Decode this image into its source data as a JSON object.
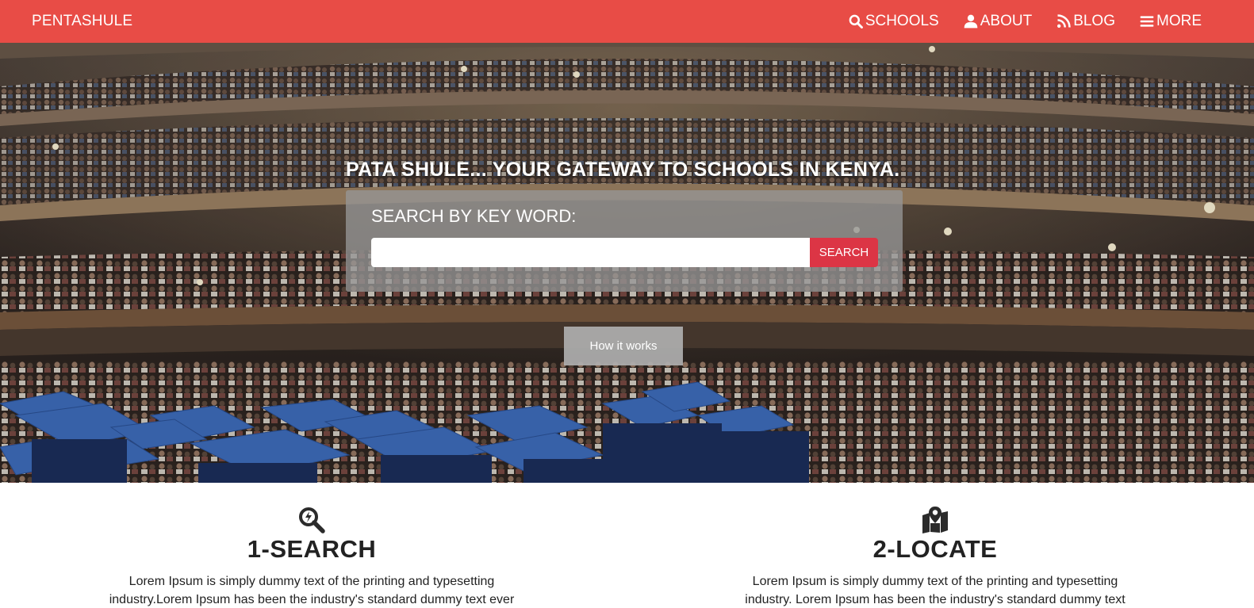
{
  "navbar": {
    "brand": "PENTASHULE",
    "links": [
      {
        "label": "SCHOOLS",
        "icon": "search-icon"
      },
      {
        "label": "ABOUT",
        "icon": "user-icon"
      },
      {
        "label": "BLOG",
        "icon": "rss-icon"
      },
      {
        "label": "MORE",
        "icon": "menu-icon"
      }
    ]
  },
  "hero": {
    "title": "PATA SHULE... YOUR GATEWAY TO SCHOOLS IN KENYA.",
    "search_label": "SEARCH BY KEY WORD:",
    "search_value": "",
    "search_button": "SEARCH",
    "how_button": "How it works"
  },
  "features": [
    {
      "title": "1-SEARCH",
      "icon": "search-bolt-icon",
      "text": "Lorem Ipsum is simply dummy text of the printing and typesetting industry.Lorem Ipsum has been the industry's standard dummy text ever"
    },
    {
      "title": "2-LOCATE",
      "icon": "map-marker-icon",
      "text": "Lorem Ipsum is simply dummy text of the printing and typesetting industry. Lorem Ipsum has been the industry's standard dummy text ever"
    }
  ],
  "colors": {
    "navbar": "#e84c46",
    "search_button": "#dc3545",
    "cap_blue": "#3f6fc0"
  }
}
